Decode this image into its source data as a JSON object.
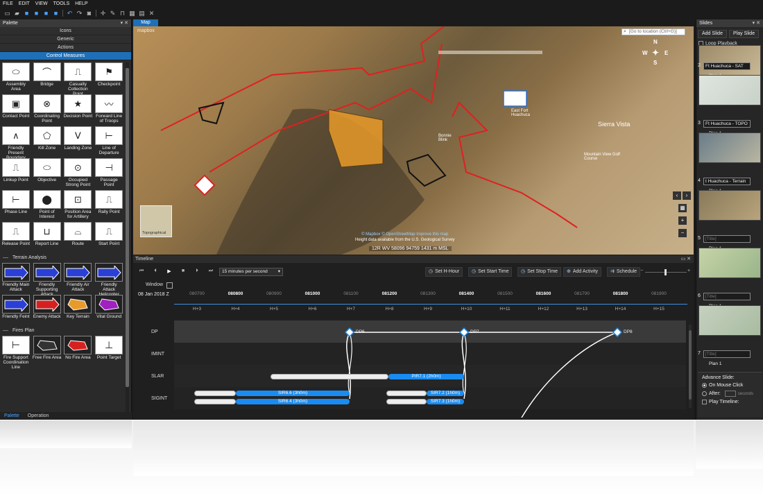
{
  "menu": [
    "FILE",
    "EDIT",
    "VIEW",
    "TOOLS",
    "HELP"
  ],
  "palette": {
    "title": "Palette",
    "categories": [
      "Icons",
      "Generic",
      "Actions",
      "Control Measures"
    ],
    "active_category": "Control Measures",
    "rows": [
      [
        "Assembly Area",
        "Bridge",
        "Casualty Collection Point",
        "Checkpoint"
      ],
      [
        "Contact Point",
        "Coordinating Point",
        "Decision Point",
        "Forward Line of Troops"
      ],
      [
        "Friendly Present Boundary",
        "Kill Zone",
        "Landing Zone",
        "Line of Departure"
      ],
      [
        "Linkup Point",
        "Objective",
        "Occupied Strong Point",
        "Passage Point"
      ],
      [
        "Phase Line",
        "Point of Interest",
        "Position Area for Artillery",
        "Rally Point"
      ],
      [
        "Release Point",
        "Report Line",
        "Route",
        "Start Point"
      ]
    ],
    "terrain_section": "Terrain Analysis",
    "terrain_rows": [
      [
        "Friendly Main Attack",
        "Friendly Supporting Attack",
        "Friendly Air Attack",
        "Friendly Attack Helicopter"
      ],
      [
        "Friendly Feint",
        "Enemy Attack",
        "Key Terrain",
        "Vital Ground"
      ]
    ],
    "fires_section": "Fires Plan",
    "fires_rows": [
      [
        "Fire Support Coordination Line",
        "Free Fire Area",
        "No Fire Area",
        "Point Target"
      ]
    ],
    "tabs": [
      "Palette",
      "Operation"
    ]
  },
  "map": {
    "tab": "Map",
    "search_placeholder": "[Go to location (Ctrl+G)]",
    "logo": "mapbox",
    "attribution_1": "© Mapbox © OpenStreetMap Improve this map",
    "attribution_2": "Height data available from the U.S. Geological Survey",
    "coords": "12R WV 58096 94759    1431 m MSL",
    "minimap_label": "Topographical",
    "place_labels": [
      "Sierra Vista",
      "East Fort Huachuca",
      "Bonnie Blink",
      "Mountain View Golf Course"
    ],
    "compass": {
      "n": "N",
      "s": "S",
      "e": "E",
      "w": "W"
    }
  },
  "timeline": {
    "title": "Timeline",
    "speed": "15 minutes per second",
    "buttons": [
      "Set H-Hour",
      "Set Start Time",
      "Set Stop Time",
      "Add Activity",
      "Schedule"
    ],
    "window_label": "Window",
    "date": "08 Jan 2018 Z",
    "times": [
      "080700",
      "080800",
      "080900",
      "081000",
      "081100",
      "081200",
      "081300",
      "081400",
      "081500",
      "081600",
      "081700",
      "081800",
      "081900"
    ],
    "bold_times": [
      "080800",
      "081000",
      "081200",
      "081400",
      "081600",
      "081800"
    ],
    "hours": [
      "H+3",
      "H+4",
      "H+5",
      "H+6",
      "H+7",
      "H+8",
      "H+9",
      "H+10",
      "H+11",
      "H+12",
      "H+13",
      "H+14",
      "H+15"
    ],
    "lanes": [
      "DP",
      "IMINT",
      "SLAR",
      "SIGINT"
    ],
    "dps": [
      "DP6",
      "DP7",
      "DP8"
    ],
    "bars": {
      "pir": "PIR7.1 (2h0m)",
      "sir1": "SIR6.6 (3h0m)",
      "sir2": "SIR6.4 (3h0m)",
      "sir3": "SIR7.2 (1h0m)",
      "sir4": "SIR7.3 (1h0m)"
    }
  },
  "slides": {
    "title": "Slides",
    "add": "Add Slide",
    "play": "Play Slide",
    "loop": "Loop Playback",
    "items": [
      {
        "num": "2",
        "title": "Ft Huachuca - SAT",
        "plan": "Plan 1"
      },
      {
        "num": "3",
        "title": "Ft Huachuca - TOPO",
        "plan": "Plan 1"
      },
      {
        "num": "4",
        "title": "t Huachuca - Terrain",
        "plan": "Plan 1"
      },
      {
        "num": "5",
        "title": "[Title]",
        "plan": "Plan 1"
      },
      {
        "num": "6",
        "title": "[Title]",
        "plan": "Plan 1"
      },
      {
        "num": "7",
        "title": "[Title]",
        "plan": "Plan 1"
      }
    ],
    "advance_label": "Advance Slide:",
    "on_click": "On Mouse Click",
    "after": "After:",
    "seconds": "seconds",
    "play_timeline": "Play Timeline:"
  },
  "colors": {
    "accent": "#1e6fb8",
    "bar": "#1a8bf0",
    "border_red": "#e02020",
    "objective": "#e89a2a"
  }
}
